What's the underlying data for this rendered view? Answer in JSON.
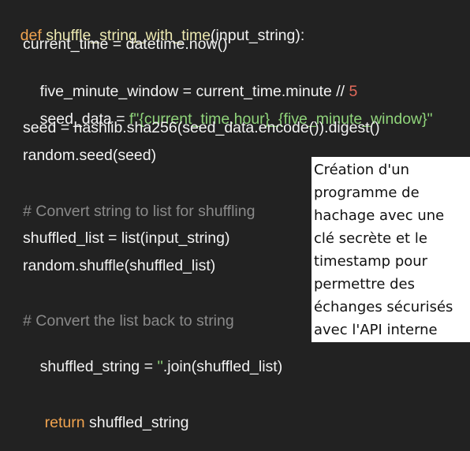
{
  "code": {
    "line1": {
      "kw": "def",
      "space": " ",
      "fn": "shuffle_string_with_time",
      "rest": "(input_string):"
    },
    "line2": "current_time = datetime.now()",
    "line3": {
      "pre": "five_minute_window = current_time.minute // ",
      "num": "5"
    },
    "line4": {
      "pre": "seed_data = ",
      "str": "f\"{current_time.hour}_{five_minute_window}\""
    },
    "line5": "seed = hashlib.sha256(seed_data.encode()).digest()",
    "line6": "random.seed(seed)",
    "line7": "# Convert string to list for shuffling",
    "line8": "shuffled_list = list(input_string)",
    "line9": "random.shuffle(shuffled_list)",
    "line10": "# Convert the list back to string",
    "line11": {
      "pre": "shuffled_string = ",
      "str": "''",
      "post": ".join(shuffled_list)"
    },
    "line12": {
      "kw": "return",
      "space": " ",
      "rest": "shuffled_string"
    }
  },
  "note": {
    "lines": [
      "Création d'un",
      "programme de",
      "hachage avec une",
      "clé secrète et le",
      "timestamp pour",
      "permettre des",
      "échanges sécurisés",
      "avec l'API interne"
    ]
  },
  "colors": {
    "background": "#222222",
    "keyword": "#f0a34f",
    "function_name": "#ece8b0",
    "number": "#e36a5b",
    "string": "#8fd37a",
    "comment": "#8a8a8a",
    "note_background": "#ffffff"
  }
}
